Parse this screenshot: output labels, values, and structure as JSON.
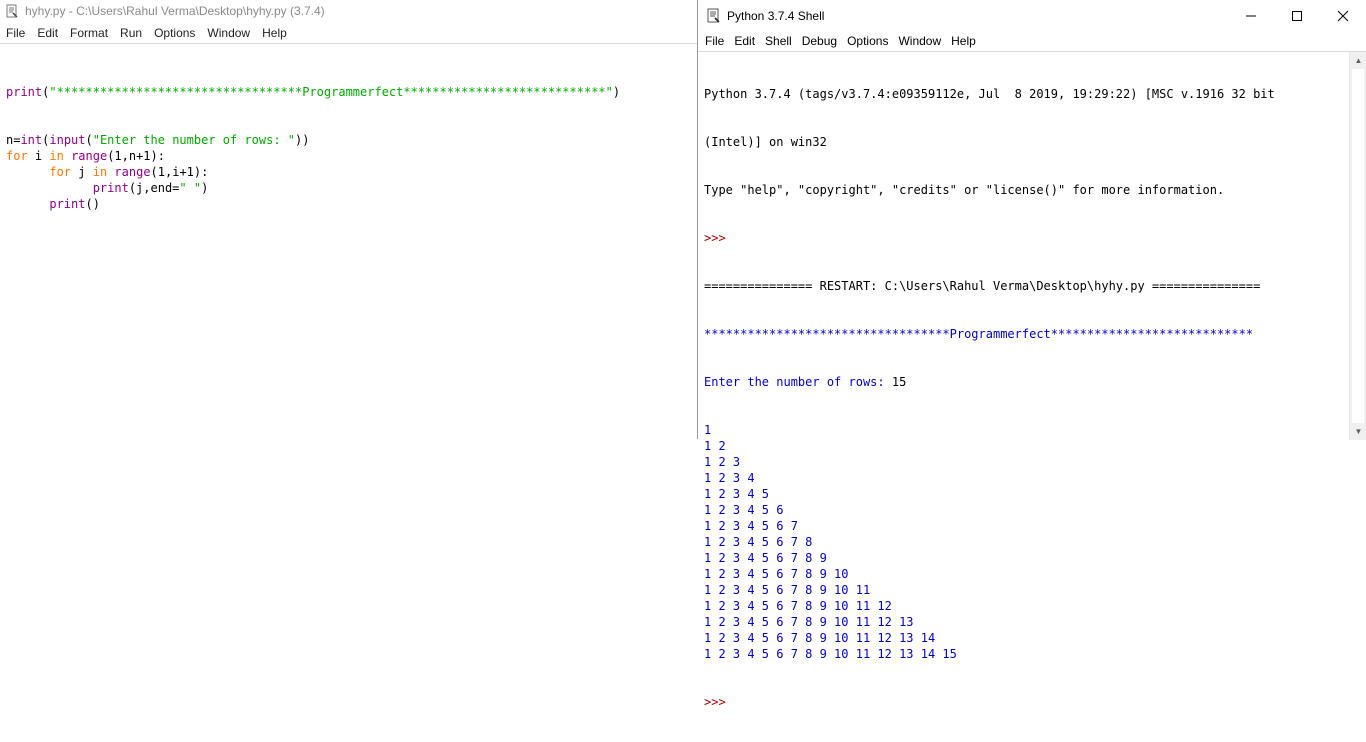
{
  "editor": {
    "title": "hyhy.py - C:\\Users\\Rahul Verma\\Desktop\\hyhy.py (3.7.4)",
    "menu": [
      "File",
      "Edit",
      "Format",
      "Run",
      "Options",
      "Window",
      "Help"
    ],
    "code": {
      "l1_fn": "print",
      "l1_open": "(",
      "l1_str": "\"**********************************Programmerfect****************************\"",
      "l1_close": ")",
      "l2_prefix": "n=",
      "l2_int": "int",
      "l2_paren": "(",
      "l2_input": "input",
      "l2_paren2": "(",
      "l2_str": "\"Enter the number of rows: \"",
      "l2_close": "))",
      "l3_for": "for",
      "l3_mid": " i ",
      "l3_in": "in",
      "l3_sp": " ",
      "l3_range": "range",
      "l3_args": "(1,n+1):",
      "l4_indent": "      ",
      "l4_for": "for",
      "l4_mid": " j ",
      "l4_in": "in",
      "l4_sp": " ",
      "l4_range": "range",
      "l4_args": "(1,i+1):",
      "l5_indent": "            ",
      "l5_print": "print",
      "l5_args": "(j,end=",
      "l5_str": "\" \"",
      "l5_close": ")",
      "l6_indent": "      ",
      "l6_print": "print",
      "l6_args": "()"
    }
  },
  "shell": {
    "title": "Python 3.7.4 Shell",
    "window_buttons": {
      "minimize": "—",
      "maximize": "☐",
      "close": "✕"
    },
    "menu": [
      "File",
      "Edit",
      "Shell",
      "Debug",
      "Options",
      "Window",
      "Help"
    ],
    "banner_line1": "Python 3.7.4 (tags/v3.7.4:e09359112e, Jul  8 2019, 19:29:22) [MSC v.1916 32 bit",
    "banner_line2": "(Intel)] on win32",
    "banner_line3": "Type \"help\", \"copyright\", \"credits\" or \"license()\" for more information.",
    "prompt": ">>>",
    "restart_line": "=============== RESTART: C:\\Users\\Rahul Verma\\Desktop\\hyhy.py ===============",
    "program_header": "**********************************Programmerfect****************************",
    "input_prompt": "Enter the number of rows: ",
    "input_value": "15",
    "output_rows": [
      "1",
      "1 2",
      "1 2 3",
      "1 2 3 4",
      "1 2 3 4 5",
      "1 2 3 4 5 6",
      "1 2 3 4 5 6 7",
      "1 2 3 4 5 6 7 8",
      "1 2 3 4 5 6 7 8 9",
      "1 2 3 4 5 6 7 8 9 10",
      "1 2 3 4 5 6 7 8 9 10 11",
      "1 2 3 4 5 6 7 8 9 10 11 12",
      "1 2 3 4 5 6 7 8 9 10 11 12 13",
      "1 2 3 4 5 6 7 8 9 10 11 12 13 14",
      "1 2 3 4 5 6 7 8 9 10 11 12 13 14 15"
    ],
    "final_prompt": ">>>"
  },
  "colors": {
    "keyword": "#ff7700",
    "builtin": "#900090",
    "string": "#00aa00",
    "prompt": "#a70000",
    "output": "#0000cc"
  }
}
